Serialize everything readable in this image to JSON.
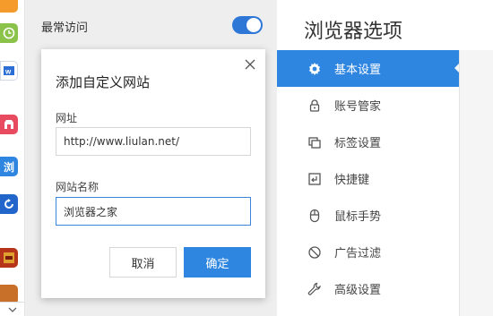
{
  "middle": {
    "row_label": "最常访问",
    "toggle_on": true
  },
  "dialog": {
    "title": "添加自定义网站",
    "url_label": "网址",
    "url_value": "http://www.liulan.net/",
    "name_label": "网站名称",
    "name_value": "浏览器之家",
    "cancel_label": "取消",
    "ok_label": "确定"
  },
  "settings": {
    "title": "浏览器选项",
    "nav": [
      {
        "label": "基本设置",
        "icon": "gear-icon",
        "active": true
      },
      {
        "label": "账号管家",
        "icon": "lock-icon",
        "active": false
      },
      {
        "label": "标签设置",
        "icon": "tabs-icon",
        "active": false
      },
      {
        "label": "快捷键",
        "icon": "keyboard-key-icon",
        "active": false
      },
      {
        "label": "鼠标手势",
        "icon": "mouse-icon",
        "active": false
      },
      {
        "label": "广告过滤",
        "icon": "block-icon",
        "active": false
      },
      {
        "label": "高级设置",
        "icon": "wrench-icon",
        "active": false
      }
    ]
  },
  "app_strip": {
    "apps": [
      {
        "icon": "app-top-icon",
        "color": "#f59b2b"
      },
      {
        "icon": "clock-app-icon",
        "color": "#8bc34a"
      },
      {
        "icon": "word-doc-icon",
        "color": "#2b6fd6"
      },
      {
        "icon": "store-app-icon",
        "color": "#e84a5f"
      },
      {
        "icon": "browser-app-icon",
        "color": "#2f86e0",
        "glyph": "浏"
      },
      {
        "icon": "refresh-app-icon",
        "color": "#2266cc"
      },
      {
        "icon": "game-app-icon",
        "color": "#b5341a"
      },
      {
        "icon": "game2-app-icon",
        "color": "#c8702a"
      }
    ]
  },
  "colors": {
    "accent": "#2f86e0",
    "toggle": "#2f77d6",
    "panel_bg": "#eeeeee"
  }
}
